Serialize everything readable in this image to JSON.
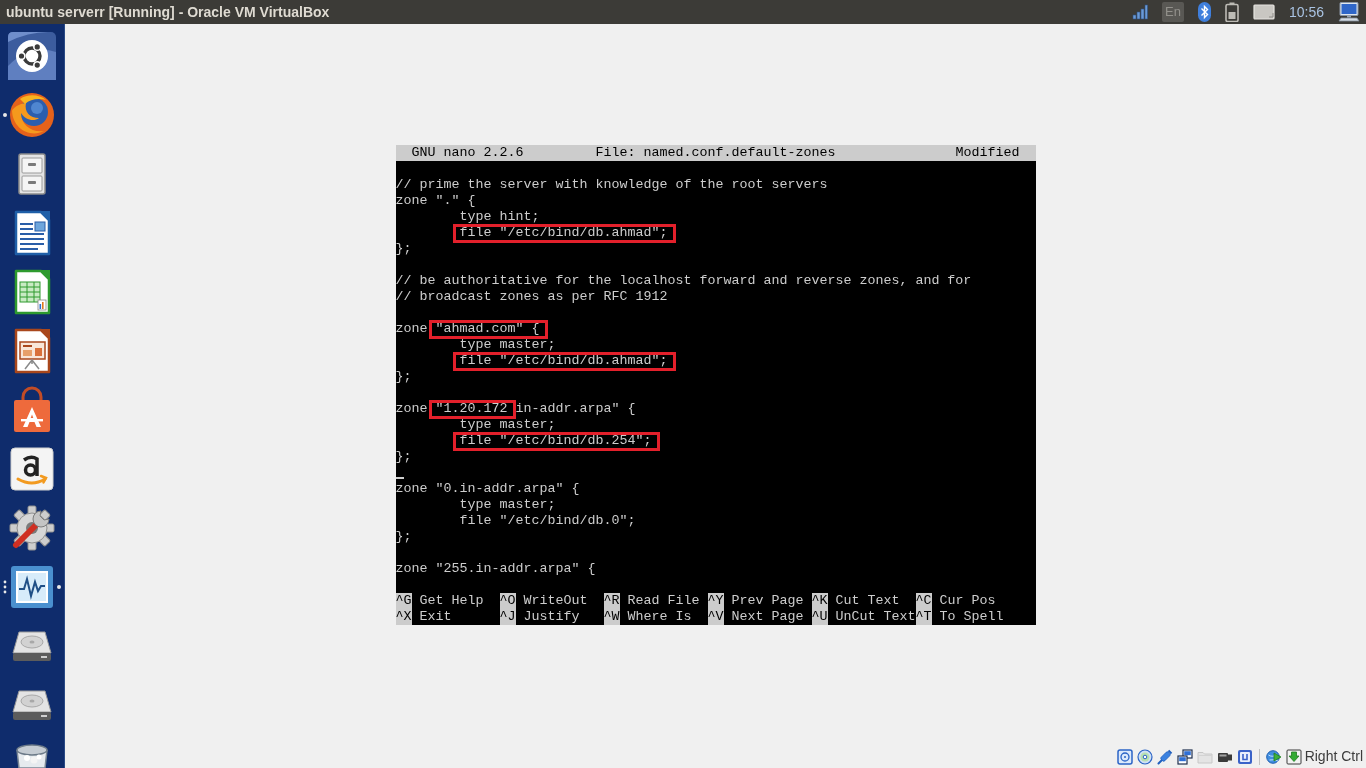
{
  "top_bar": {
    "title": "ubuntu serverr [Running] - Oracle VM VirtualBox",
    "keyboard_layout": "En",
    "clock": "10:56"
  },
  "launcher": {
    "items": [
      {
        "kind": "logo",
        "running": false,
        "several_windows": false,
        "focused": false
      },
      {
        "kind": "browser",
        "running": true,
        "several_windows": false,
        "focused": false
      },
      {
        "kind": "cabinet",
        "running": false,
        "several_windows": false,
        "focused": false
      },
      {
        "kind": "document",
        "running": false,
        "several_windows": false,
        "focused": false
      },
      {
        "kind": "spreadsheet",
        "running": false,
        "several_windows": false,
        "focused": false
      },
      {
        "kind": "presentation",
        "running": false,
        "several_windows": false,
        "focused": false
      },
      {
        "kind": "bag",
        "running": false,
        "several_windows": false,
        "focused": false
      },
      {
        "kind": "store",
        "running": false,
        "several_windows": false,
        "focused": false
      },
      {
        "kind": "settings",
        "running": false,
        "several_windows": false,
        "focused": false
      },
      {
        "kind": "monitor",
        "running": true,
        "several_windows": true,
        "focused": true
      },
      {
        "kind": "drive",
        "running": false,
        "several_windows": false,
        "focused": false
      },
      {
        "kind": "drive",
        "running": false,
        "several_windows": false,
        "focused": false
      },
      {
        "kind": "trash",
        "running": false,
        "several_windows": false,
        "focused": false
      }
    ]
  },
  "editor": {
    "header": {
      "version": "GNU nano 2.2.6",
      "file": "File: named.conf.default-zones",
      "status": "Modified"
    },
    "lines": [
      {
        "kind": "blank"
      },
      {
        "kind": "text",
        "segments": [
          {
            "text": "// prime the server with knowledge of the root servers",
            "highlighted": false
          }
        ]
      },
      {
        "kind": "text",
        "segments": [
          {
            "text": "zone \".\" {",
            "highlighted": false
          }
        ],
        "children": [
          {
            "kind": "text",
            "segments": [
              {
                "text": "type hint;",
                "highlighted": false
              }
            ]
          },
          {
            "kind": "text",
            "segments": [
              {
                "text": "file \"/etc/bind/db.ahmad\";",
                "highlighted": true
              }
            ]
          }
        ]
      },
      {
        "kind": "text",
        "segments": [
          {
            "text": "};",
            "highlighted": false
          }
        ]
      },
      {
        "kind": "blank"
      },
      {
        "kind": "text",
        "segments": [
          {
            "text": "// be authoritative for the localhost forward and reverse zones, and for",
            "highlighted": false
          }
        ]
      },
      {
        "kind": "text",
        "segments": [
          {
            "text": "// broadcast zones as per RFC 1912",
            "highlighted": false
          }
        ]
      },
      {
        "kind": "blank"
      },
      {
        "kind": "text",
        "segments": [
          {
            "text": "zone",
            "highlighted": false
          },
          {
            "text": "\"ahmad.com\" {",
            "highlighted": true
          }
        ],
        "children": [
          {
            "kind": "text",
            "segments": [
              {
                "text": "type master;",
                "highlighted": false
              }
            ]
          },
          {
            "kind": "text",
            "segments": [
              {
                "text": "file \"/etc/bind/db.ahmad\";",
                "highlighted": true
              }
            ]
          }
        ]
      },
      {
        "kind": "text",
        "segments": [
          {
            "text": "};",
            "highlighted": false
          }
        ]
      },
      {
        "kind": "blank"
      },
      {
        "kind": "text",
        "segments": [
          {
            "text": "zone",
            "highlighted": false
          },
          {
            "text": "\"1.20.172",
            "highlighted": true
          },
          {
            "text": "in-addr.arpa\" {",
            "highlighted": false
          }
        ],
        "children": [
          {
            "kind": "text",
            "segments": [
              {
                "text": "type master;",
                "highlighted": false
              }
            ]
          },
          {
            "kind": "text",
            "segments": [
              {
                "text": "file \"/etc/bind/db.254\";",
                "highlighted": true
              }
            ]
          }
        ]
      },
      {
        "kind": "text",
        "segments": [
          {
            "text": "};",
            "highlighted": false
          }
        ]
      },
      {
        "kind": "cursor"
      },
      {
        "kind": "text",
        "segments": [
          {
            "text": "zone \"0.in-addr.arpa\" {",
            "highlighted": false
          }
        ],
        "children": [
          {
            "kind": "text",
            "segments": [
              {
                "text": "type master;",
                "highlighted": false
              }
            ]
          },
          {
            "kind": "text",
            "segments": [
              {
                "text": "file \"/etc/bind/db.0\";",
                "highlighted": false
              }
            ]
          }
        ]
      },
      {
        "kind": "text",
        "segments": [
          {
            "text": "};",
            "highlighted": false
          }
        ]
      },
      {
        "kind": "blank"
      },
      {
        "kind": "text",
        "segments": [
          {
            "text": "zone \"255.in-addr.arpa\" {",
            "highlighted": false
          }
        ]
      }
    ],
    "shortcuts": [
      {
        "key": "^G",
        "label": "Get Help"
      },
      {
        "key": "^O",
        "label": "WriteOut"
      },
      {
        "key": "^R",
        "label": "Read File"
      },
      {
        "key": "^Y",
        "label": "Prev Page"
      },
      {
        "key": "^K",
        "label": "Cut Text"
      },
      {
        "key": "^C",
        "label": "Cur Pos"
      },
      {
        "key": "^X",
        "label": "Exit"
      },
      {
        "key": "^J",
        "label": "Justify"
      },
      {
        "key": "^W",
        "label": "Where Is"
      },
      {
        "key": "^V",
        "label": "Next Page"
      },
      {
        "key": "^U",
        "label": "UnCut Text"
      },
      {
        "key": "^T",
        "label": "To Spell"
      }
    ]
  },
  "status_bar": {
    "devices": [
      {
        "kind": "disk",
        "active": true
      },
      {
        "kind": "disc",
        "active": true
      },
      {
        "kind": "plug",
        "active": true
      },
      {
        "kind": "network",
        "active": true
      },
      {
        "kind": "folder",
        "active": false
      },
      {
        "kind": "camera",
        "active": true
      },
      {
        "kind": "tile",
        "active": true
      }
    ],
    "capture": [
      {
        "kind": "globe",
        "active": true
      },
      {
        "kind": "arrow",
        "active": true
      }
    ],
    "host_key": "Right Ctrl"
  }
}
